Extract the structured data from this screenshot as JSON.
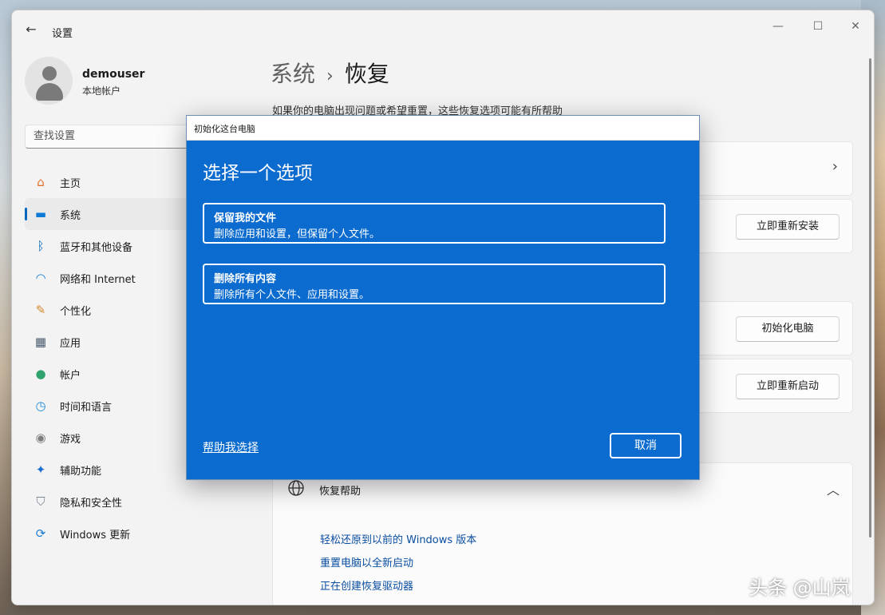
{
  "window": {
    "title": "设置",
    "back_icon": "arrow-left-icon",
    "controls": {
      "minimize": "—",
      "maximize": "☐",
      "close": "✕"
    }
  },
  "profile": {
    "name": "demouser",
    "account_type": "本地帐户"
  },
  "search": {
    "placeholder": "查找设置"
  },
  "sidebar": {
    "items": [
      {
        "label": "主页",
        "icon": "home-icon",
        "symbol": "⌂",
        "color": "#e56c28"
      },
      {
        "label": "系统",
        "icon": "monitor-icon",
        "symbol": "▬",
        "color": "#0f7bd6",
        "active": true
      },
      {
        "label": "蓝牙和其他设备",
        "icon": "bluetooth-icon",
        "symbol": "ᛒ",
        "color": "#0067c0"
      },
      {
        "label": "网络和 Internet",
        "icon": "wifi-icon",
        "symbol": "◠",
        "color": "#1a7fd4"
      },
      {
        "label": "个性化",
        "icon": "brush-icon",
        "symbol": "✎",
        "color": "#d4892b"
      },
      {
        "label": "应用",
        "icon": "apps-icon",
        "symbol": "▦",
        "color": "#4a5a6e"
      },
      {
        "label": "帐户",
        "icon": "account-icon",
        "symbol": "●",
        "color": "#2fa36b"
      },
      {
        "label": "时间和语言",
        "icon": "clock-globe-icon",
        "symbol": "◷",
        "color": "#1f8bd8"
      },
      {
        "label": "游戏",
        "icon": "gamepad-icon",
        "symbol": "◉",
        "color": "#7d7d7d"
      },
      {
        "label": "辅助功能",
        "icon": "accessibility-icon",
        "symbol": "✦",
        "color": "#1a6ed0"
      },
      {
        "label": "隐私和安全性",
        "icon": "shield-icon",
        "symbol": "⛉",
        "color": "#7a8696"
      },
      {
        "label": "Windows 更新",
        "icon": "windows-update-icon",
        "symbol": "⟳",
        "color": "#1b7fd6"
      }
    ]
  },
  "main": {
    "breadcrumb": {
      "parent": "系统",
      "separator": "›",
      "current": "恢复"
    },
    "description": "如果你的电脑出现问题或希望重置，这些恢复选项可能有所帮助",
    "buttons": {
      "reinstall": "立即重新安装",
      "reset": "初始化电脑",
      "restart": "立即重新启动"
    },
    "help_section": {
      "title": "恢复帮助",
      "links": [
        "轻松还原到以前的 Windows 版本",
        "重置电脑以全新启动",
        "正在创建恢复驱动器"
      ]
    }
  },
  "dialog": {
    "title": "初始化这台电脑",
    "heading": "选择一个选项",
    "options": [
      {
        "title": "保留我的文件",
        "desc": "删除应用和设置，但保留个人文件。"
      },
      {
        "title": "删除所有内容",
        "desc": "删除所有个人文件、应用和设置。"
      }
    ],
    "help_link": "帮助我选择",
    "cancel": "取消",
    "bg_color": "#0b6bce"
  },
  "watermark": "头条 @山岚"
}
